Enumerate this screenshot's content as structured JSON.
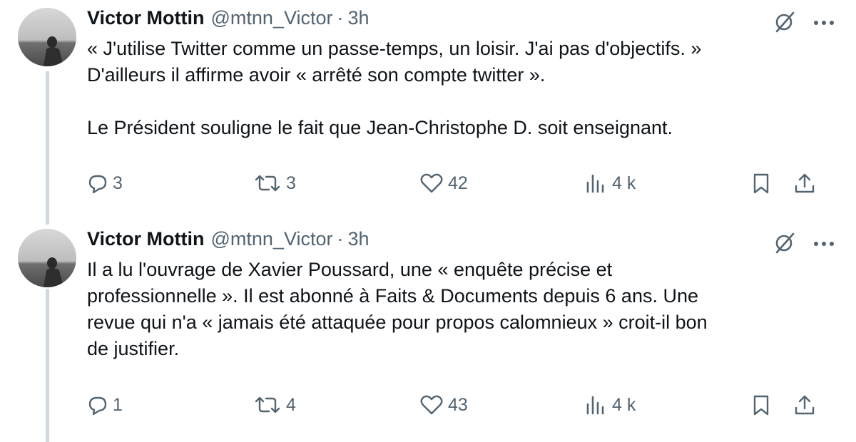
{
  "tweets": [
    {
      "author": "Victor Mottin",
      "handle": "@mtnn_Victor",
      "separator": "·",
      "time": "3h",
      "lines": [
        "« J'utilise Twitter comme un passe-temps, un loisir. J'ai pas d'objectifs. »",
        "D'ailleurs il affirme avoir « arrêté son compte twitter ».",
        "",
        "Le Président souligne le fait que Jean-Christophe D. soit enseignant."
      ],
      "replies": "3",
      "reposts": "3",
      "likes": "42",
      "views": "4 k"
    },
    {
      "author": "Victor Mottin",
      "handle": "@mtnn_Victor",
      "separator": "·",
      "time": "3h",
      "lines": [
        "Il a lu l'ouvrage de Xavier Poussard, une « enquête précise et",
        "professionnelle ». Il est abonné à Faits & Documents depuis 6 ans. Une",
        "revue qui n'a « jamais été attaquée pour propos calomnieux » croit-il bon",
        "de justifier."
      ],
      "replies": "1",
      "reposts": "4",
      "likes": "43",
      "views": "4 k"
    }
  ],
  "icons": [
    "grok-icon",
    "more-icon",
    "reply-icon",
    "repost-icon",
    "like-icon",
    "views-icon",
    "bookmark-icon",
    "share-icon"
  ],
  "colors": {
    "text": "#0f1419",
    "secondary": "#536471",
    "thread_line": "#cfd9de"
  }
}
